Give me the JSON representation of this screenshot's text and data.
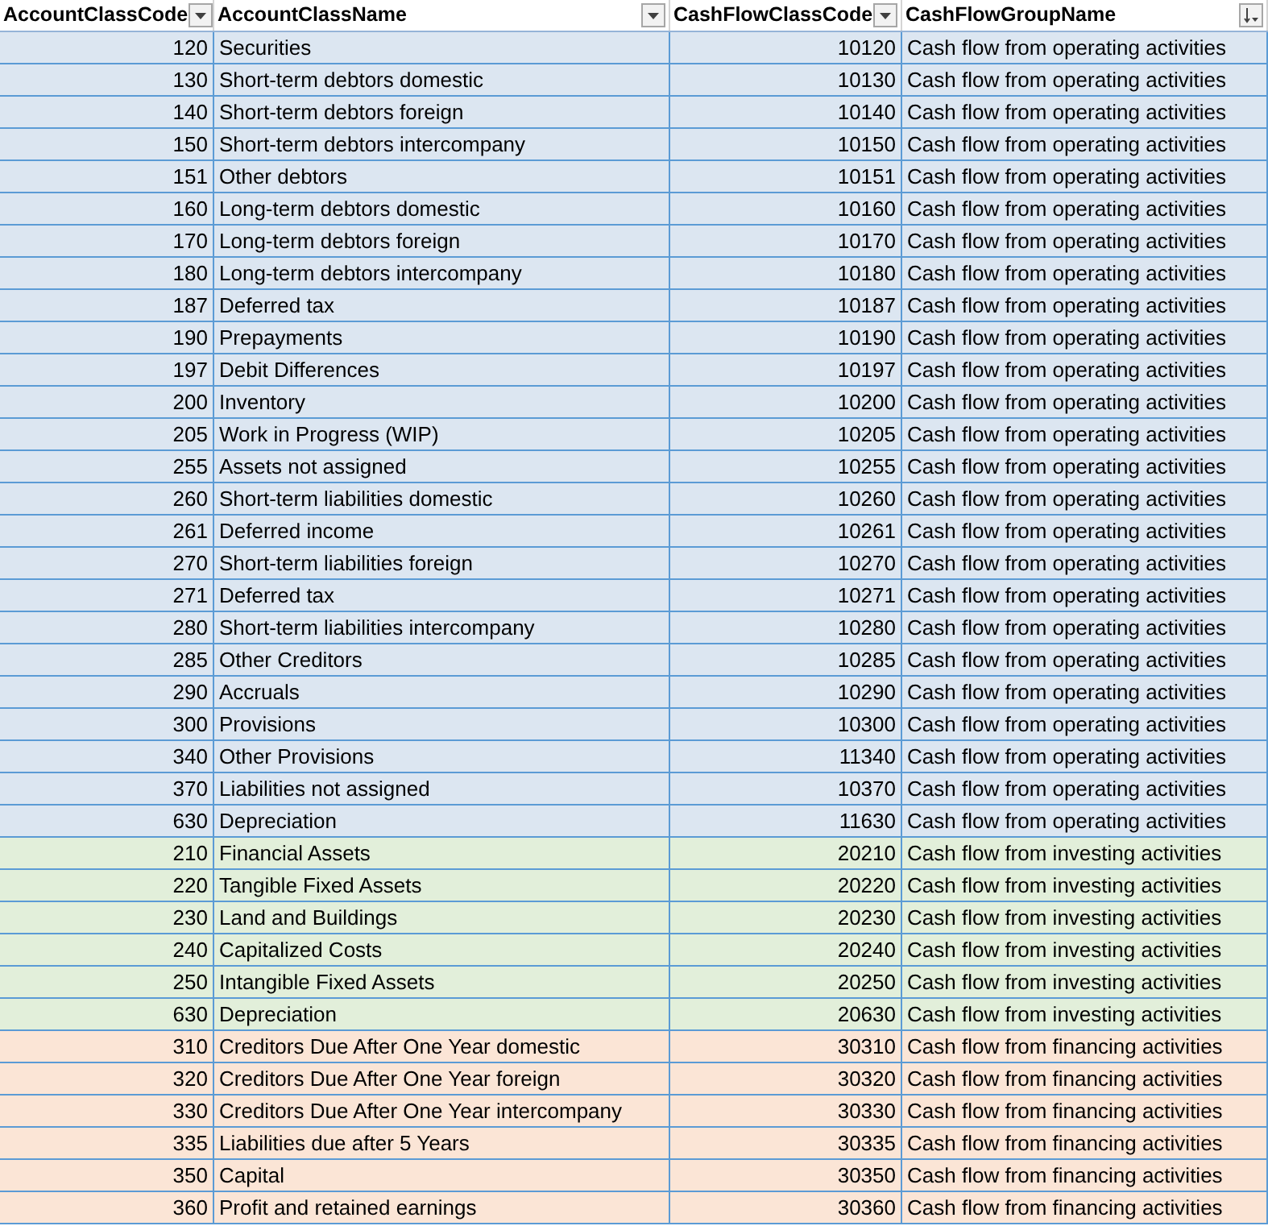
{
  "columns": [
    {
      "label": "AccountClassCode",
      "kind": "filter"
    },
    {
      "label": "AccountClassName",
      "kind": "filter"
    },
    {
      "label": "CashFlowClassCode",
      "kind": "filter"
    },
    {
      "label": "CashFlowGroupName",
      "kind": "sorted"
    }
  ],
  "rows": [
    {
      "cells": [
        "120",
        "Securities",
        "10120",
        "Cash flow from operating activities"
      ],
      "color": "#dce6f1"
    },
    {
      "cells": [
        "130",
        "Short-term debtors domestic",
        "10130",
        "Cash flow from operating activities"
      ],
      "color": "#dce6f1"
    },
    {
      "cells": [
        "140",
        "Short-term debtors foreign",
        "10140",
        "Cash flow from operating activities"
      ],
      "color": "#dce6f1"
    },
    {
      "cells": [
        "150",
        "Short-term debtors intercompany",
        "10150",
        "Cash flow from operating activities"
      ],
      "color": "#dce6f1"
    },
    {
      "cells": [
        "151",
        "Other debtors",
        "10151",
        "Cash flow from operating activities"
      ],
      "color": "#dce6f1"
    },
    {
      "cells": [
        "160",
        "Long-term debtors domestic",
        "10160",
        "Cash flow from operating activities"
      ],
      "color": "#dce6f1"
    },
    {
      "cells": [
        "170",
        "Long-term debtors foreign",
        "10170",
        "Cash flow from operating activities"
      ],
      "color": "#dce6f1"
    },
    {
      "cells": [
        "180",
        "Long-term debtors intercompany",
        "10180",
        "Cash flow from operating activities"
      ],
      "color": "#dce6f1"
    },
    {
      "cells": [
        "187",
        "Deferred tax",
        "10187",
        "Cash flow from operating activities"
      ],
      "color": "#dce6f1"
    },
    {
      "cells": [
        "190",
        "Prepayments",
        "10190",
        "Cash flow from operating activities"
      ],
      "color": "#dce6f1"
    },
    {
      "cells": [
        "197",
        "Debit Differences",
        "10197",
        "Cash flow from operating activities"
      ],
      "color": "#dce6f1"
    },
    {
      "cells": [
        "200",
        "Inventory",
        "10200",
        "Cash flow from operating activities"
      ],
      "color": "#dce6f1"
    },
    {
      "cells": [
        "205",
        "Work in Progress (WIP)",
        "10205",
        "Cash flow from operating activities"
      ],
      "color": "#dce6f1"
    },
    {
      "cells": [
        "255",
        "Assets not assigned",
        "10255",
        "Cash flow from operating activities"
      ],
      "color": "#dce6f1"
    },
    {
      "cells": [
        "260",
        "Short-term liabilities domestic",
        "10260",
        "Cash flow from operating activities"
      ],
      "color": "#dce6f1"
    },
    {
      "cells": [
        "261",
        "Deferred income",
        "10261",
        "Cash flow from operating activities"
      ],
      "color": "#dce6f1"
    },
    {
      "cells": [
        "270",
        "Short-term liabilities foreign",
        "10270",
        "Cash flow from operating activities"
      ],
      "color": "#dce6f1"
    },
    {
      "cells": [
        "271",
        "Deferred tax",
        "10271",
        "Cash flow from operating activities"
      ],
      "color": "#dce6f1"
    },
    {
      "cells": [
        "280",
        "Short-term liabilities intercompany",
        "10280",
        "Cash flow from operating activities"
      ],
      "color": "#dce6f1"
    },
    {
      "cells": [
        "285",
        "Other Creditors",
        "10285",
        "Cash flow from operating activities"
      ],
      "color": "#dce6f1"
    },
    {
      "cells": [
        "290",
        "Accruals",
        "10290",
        "Cash flow from operating activities"
      ],
      "color": "#dce6f1"
    },
    {
      "cells": [
        "300",
        "Provisions",
        "10300",
        "Cash flow from operating activities"
      ],
      "color": "#dce6f1"
    },
    {
      "cells": [
        "340",
        "Other Provisions",
        "11340",
        "Cash flow from operating activities"
      ],
      "color": "#dce6f1"
    },
    {
      "cells": [
        "370",
        "Liabilities not assigned",
        "10370",
        "Cash flow from operating activities"
      ],
      "color": "#dce6f1"
    },
    {
      "cells": [
        "630",
        "Depreciation",
        "11630",
        "Cash flow from operating activities"
      ],
      "color": "#dce6f1"
    },
    {
      "cells": [
        "210",
        "Financial Assets",
        "20210",
        "Cash flow from investing activities"
      ],
      "color": "#e2efda"
    },
    {
      "cells": [
        "220",
        "Tangible Fixed Assets",
        "20220",
        "Cash flow from investing activities"
      ],
      "color": "#e2efda"
    },
    {
      "cells": [
        "230",
        "Land and Buildings",
        "20230",
        "Cash flow from investing activities"
      ],
      "color": "#e2efda"
    },
    {
      "cells": [
        "240",
        "Capitalized Costs",
        "20240",
        "Cash flow from investing activities"
      ],
      "color": "#e2efda"
    },
    {
      "cells": [
        "250",
        "Intangible Fixed Assets",
        "20250",
        "Cash flow from investing activities"
      ],
      "color": "#e2efda"
    },
    {
      "cells": [
        "630",
        "Depreciation",
        "20630",
        "Cash flow from investing activities"
      ],
      "color": "#e2efda"
    },
    {
      "cells": [
        "310",
        "Creditors Due After One Year domestic",
        "30310",
        "Cash flow from financing activities"
      ],
      "color": "#fbe5d6"
    },
    {
      "cells": [
        "320",
        "Creditors Due After One Year foreign",
        "30320",
        "Cash flow from financing activities"
      ],
      "color": "#fbe5d6"
    },
    {
      "cells": [
        "330",
        "Creditors Due After One Year intercompany",
        "30330",
        "Cash flow from financing activities"
      ],
      "color": "#fbe5d6"
    },
    {
      "cells": [
        "335",
        "Liabilities due after 5 Years",
        "30335",
        "Cash flow from financing activities"
      ],
      "color": "#fbe5d6"
    },
    {
      "cells": [
        "350",
        "Capital",
        "30350",
        "Cash flow from financing activities"
      ],
      "color": "#fbe5d6"
    },
    {
      "cells": [
        "360",
        "Profit and retained earnings",
        "30360",
        "Cash flow from financing activities"
      ],
      "color": "#fbe5d6"
    }
  ]
}
